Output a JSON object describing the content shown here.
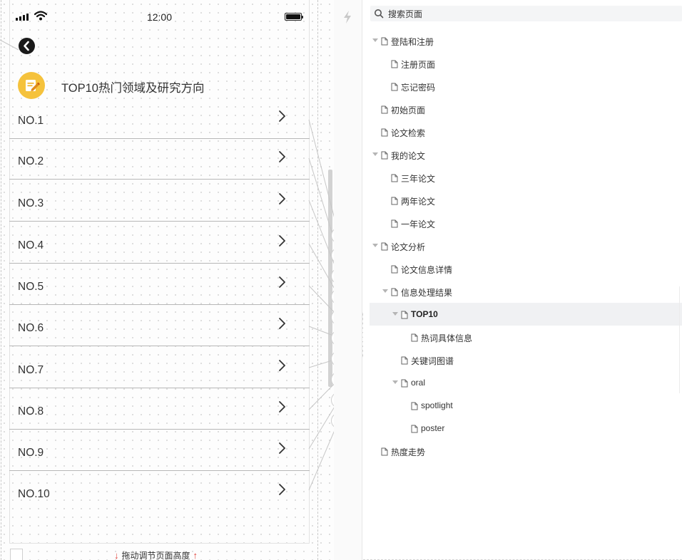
{
  "status_bar": {
    "time": "12:00"
  },
  "page": {
    "title": "TOP10热门领域及研究方向",
    "rows": [
      "NO.1",
      "NO.2",
      "NO.3",
      "NO.4",
      "NO.5",
      "NO.6",
      "NO.7",
      "NO.8",
      "NO.9",
      "NO.10"
    ]
  },
  "bottom_bar": {
    "drag_hint": "拖动调节页面高度"
  },
  "tree": {
    "search_label": "搜索页面",
    "items": [
      {
        "label": "登陆和注册",
        "depth": 0,
        "expandable": true
      },
      {
        "label": "注册页面",
        "depth": 1,
        "expandable": false
      },
      {
        "label": "忘记密码",
        "depth": 1,
        "expandable": false
      },
      {
        "label": "初始页面",
        "depth": 0,
        "expandable": false
      },
      {
        "label": "论文检索",
        "depth": 0,
        "expandable": false
      },
      {
        "label": "我的论文",
        "depth": 0,
        "expandable": true
      },
      {
        "label": "三年论文",
        "depth": 1,
        "expandable": false
      },
      {
        "label": "两年论文",
        "depth": 1,
        "expandable": false
      },
      {
        "label": "一年论文",
        "depth": 1,
        "expandable": false
      },
      {
        "label": "论文分析",
        "depth": 0,
        "expandable": true
      },
      {
        "label": "论文信息详情",
        "depth": 1,
        "expandable": false
      },
      {
        "label": "信息处理结果",
        "depth": 1,
        "expandable": true
      },
      {
        "label": "TOP10",
        "depth": 2,
        "expandable": true,
        "selected": true
      },
      {
        "label": "热词具体信息",
        "depth": 3,
        "expandable": false
      },
      {
        "label": "关键词图谱",
        "depth": 2,
        "expandable": false
      },
      {
        "label": "oral",
        "depth": 2,
        "expandable": true
      },
      {
        "label": "spotlight",
        "depth": 3,
        "expandable": false
      },
      {
        "label": "poster",
        "depth": 3,
        "expandable": false
      },
      {
        "label": "热度走势",
        "depth": 0,
        "expandable": false
      }
    ]
  },
  "icons": {
    "back": "chevron-left-circle-icon",
    "page_icon": "note-pencil-icon",
    "row": "chevron-right-icon",
    "link_node": "hand-pointer-icon",
    "mid": "lightning-icon",
    "search": "search-icon",
    "tree_item": "page-document-icon"
  },
  "colors": {
    "page_icon": "#f5c23c",
    "arrow": "#e0413a",
    "selected_row": "#f0f1f3"
  }
}
